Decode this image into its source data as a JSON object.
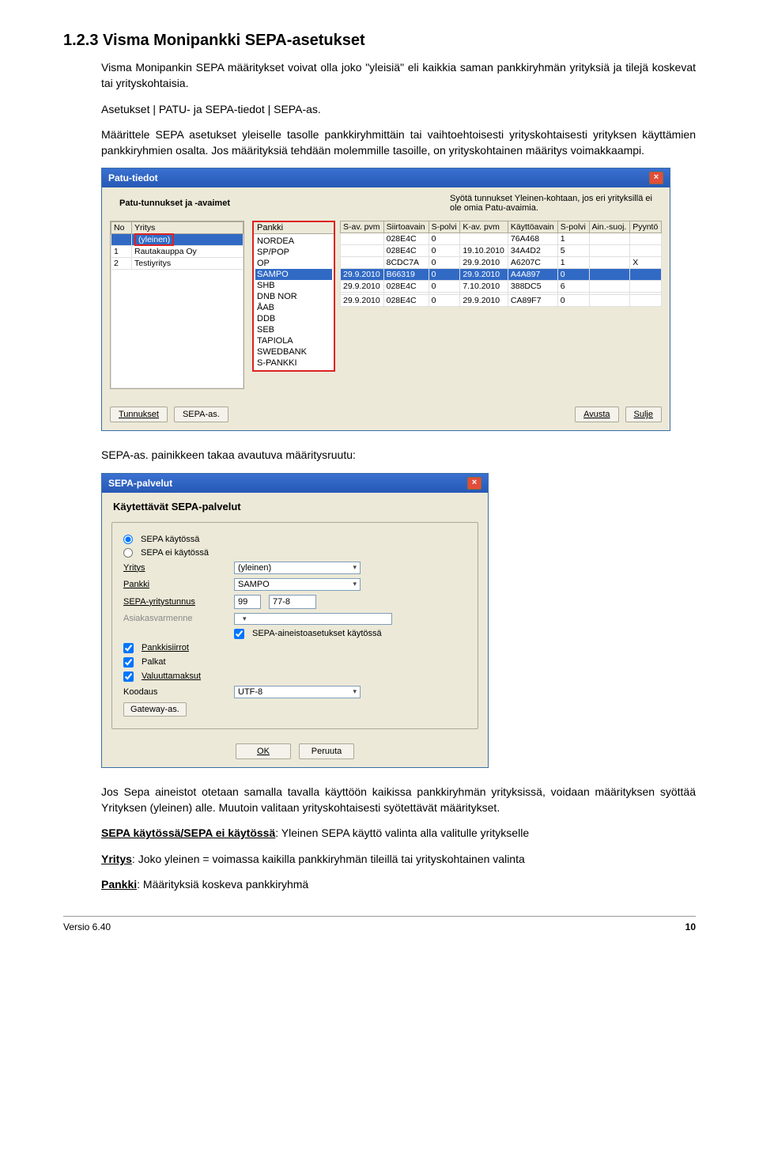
{
  "heading": "1.2.3  Visma Monipankki SEPA-asetukset",
  "para1": "Visma Monipankin SEPA määritykset voivat olla joko \"yleisiä\" eli kaikkia saman pankkiryhmän yrityksiä ja tilejä koskevat tai yrityskohtaisia.",
  "para2": "Asetukset | PATU- ja SEPA-tiedot | SEPA-as.",
  "para3": "Määrittele SEPA asetukset yleiselle tasolle pankkiryhmittäin tai vaihtoehtoisesti yrityskohtaisesti yrityksen käyttämien pankkiryhmien osalta. Jos määrityksiä tehdään molemmille tasoille, on yrityskohtainen määritys voimakkaampi.",
  "win1": {
    "title": "Patu-tiedot",
    "subtitle": "Patu-tunnukset ja -avaimet",
    "hint": "Syötä tunnukset Yleinen-kohtaan, jos eri yrityksillä ei ole omia Patu-avaimia.",
    "left_header_no": "No",
    "left_header_yr": "Yritys",
    "left_rows": [
      {
        "no": "",
        "name": "(yleinen)"
      },
      {
        "no": "1",
        "name": "Rautakauppa Oy"
      },
      {
        "no": "2",
        "name": "Testiyritys"
      }
    ],
    "pankki_label": "Pankki",
    "pankit": [
      "NORDEA",
      "SP/POP",
      "OP",
      "SAMPO",
      "SHB",
      "DNB NOR",
      "ÅAB",
      "DDB",
      "SEB",
      "TAPIOLA",
      "SWEDBANK",
      "S-PANKKI"
    ],
    "grid_headers": [
      "S-av. pvm",
      "Siirtoavain",
      "S-polvi",
      "K-av. pvm",
      "Käyttöavain",
      "S-polvi",
      "Ain.-suoj.",
      "Pyyntö"
    ],
    "grid_rows": [
      [
        "",
        "028E4C",
        "0",
        "",
        "76A468",
        "1",
        "",
        ""
      ],
      [
        "",
        "028E4C",
        "0",
        "19.10.2010",
        "34A4D2",
        "5",
        "",
        ""
      ],
      [
        "",
        "8CDC7A",
        "0",
        "29.9.2010",
        "A6207C",
        "1",
        "",
        "X"
      ],
      [
        "29.9.2010",
        "B66319",
        "0",
        "29.9.2010",
        "A4A897",
        "0",
        "",
        ""
      ],
      [
        "29.9.2010",
        "028E4C",
        "0",
        "7.10.2010",
        "388DC5",
        "6",
        "",
        ""
      ],
      [
        "",
        "",
        "",
        "",
        "",
        "",
        "",
        ""
      ],
      [
        "29.9.2010",
        "028E4C",
        "0",
        "29.9.2010",
        "CA89F7",
        "0",
        "",
        ""
      ]
    ],
    "btn_tunnukset": "Tunnukset",
    "btn_sepa": "SEPA-as.",
    "btn_avusta": "Avusta",
    "btn_sulje": "Sulje"
  },
  "caption2": "SEPA-as. painikkeen takaa avautuva määritysruutu:",
  "win2": {
    "title": "SEPA-palvelut",
    "header": "Käytettävät SEPA-palvelut",
    "radio_on": "SEPA käytössä",
    "radio_off": "SEPA ei käytössä",
    "l_yritys": "Yritys",
    "v_yritys": "(yleinen)",
    "l_pankki": "Pankki",
    "v_pankki": "SAMPO",
    "l_sepa_tunnus": "SEPA-yritystunnus",
    "v_sepa_tunnus_a": "99",
    "v_sepa_tunnus_b": "77-8",
    "l_asiakasvarmenne": "Asiakasvarmenne",
    "chk_aineisto": "SEPA-aineistoasetukset käytössä",
    "chk_pankkisiirrot": "Pankkisiirrot",
    "chk_palkat": "Palkat",
    "chk_valuutta": "Valuuttamaksut",
    "l_koodaus": "Koodaus",
    "v_koodaus": "UTF-8",
    "btn_gateway": "Gateway-as.",
    "btn_ok": "OK",
    "btn_cancel": "Peruuta"
  },
  "para4_a": "Jos Sepa aineistot otetaan samalla tavalla käyttöön kaikissa pankkiryhmän yrityksissä, voidaan määrityksen syöttää Yrityksen (yleinen) alle. Muutoin valitaan yrityskohtaisesti syötettävät määritykset.",
  "p_sepa_line_label": "SEPA käytössä/SEPA ei käytössä",
  "p_sepa_line_rest": ": Yleinen SEPA käyttö valinta alla valitulle yritykselle",
  "p_yritys_label": "Yritys",
  "p_yritys_rest": ": Joko yleinen = voimassa kaikilla pankkiryhmän tileillä tai yrityskohtainen valinta",
  "p_pankki_label": "Pankki",
  "p_pankki_rest": ": Määrityksiä koskeva pankkiryhmä",
  "footer_left": "Versio 6.40",
  "footer_right": "10"
}
